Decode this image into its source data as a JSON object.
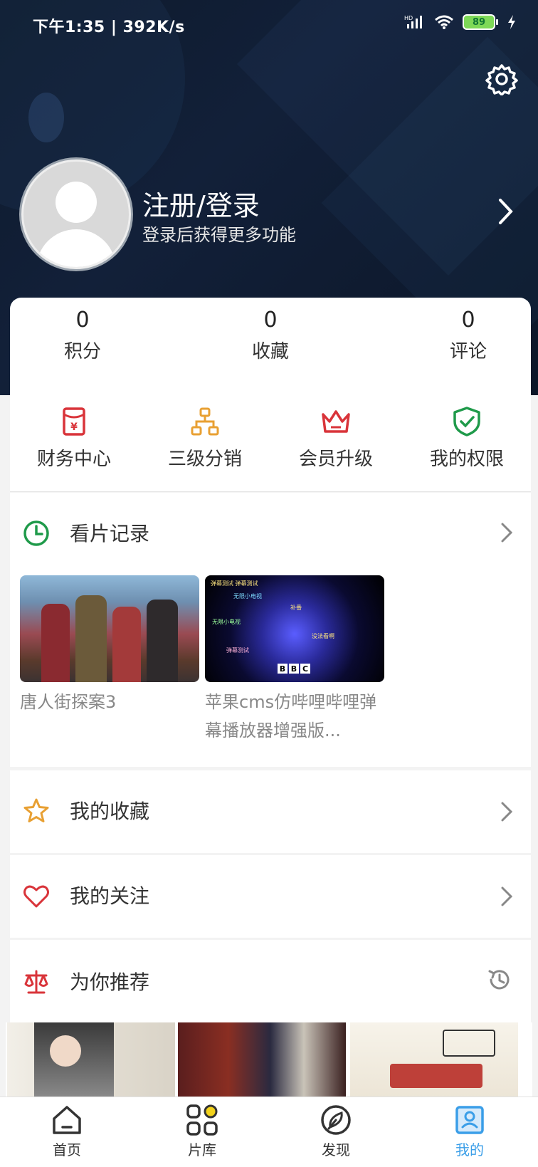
{
  "status_bar": {
    "time": "下午1:35 | 392K/s",
    "network": "HD",
    "battery": "89"
  },
  "profile": {
    "title": "注册/登录",
    "subtitle": "登录后获得更多功能"
  },
  "stats": [
    {
      "value": "0",
      "label": "积分"
    },
    {
      "value": "0",
      "label": "收藏"
    },
    {
      "value": "0",
      "label": "评论"
    }
  ],
  "quick_menu": [
    {
      "label": "财务中心",
      "icon": "red-envelope-icon",
      "color": "#d9343a"
    },
    {
      "label": "三级分销",
      "icon": "hierarchy-icon",
      "color": "#e8a033"
    },
    {
      "label": "会员升级",
      "icon": "crown-icon",
      "color": "#d9343a"
    },
    {
      "label": "我的权限",
      "icon": "shield-check-icon",
      "color": "#1f9a4a"
    }
  ],
  "history": {
    "title": "看片记录",
    "items": [
      {
        "title": "唐人街探案3"
      },
      {
        "title": "苹果cms仿哔哩哔哩弹幕播放器增强版...",
        "thumb_text": [
          "BBC"
        ]
      }
    ]
  },
  "rows": [
    {
      "label": "我的收藏",
      "icon": "star-icon"
    },
    {
      "label": "我的关注",
      "icon": "heart-icon"
    }
  ],
  "recommend": {
    "title": "为你推荐"
  },
  "nav": [
    {
      "label": "首页",
      "icon": "home-icon"
    },
    {
      "label": "片库",
      "icon": "library-icon"
    },
    {
      "label": "发现",
      "icon": "discover-icon"
    },
    {
      "label": "我的",
      "icon": "profile-icon",
      "active": true
    }
  ],
  "colors": {
    "accent": "#3a9ee8",
    "header_bg": "#0f1b30"
  }
}
